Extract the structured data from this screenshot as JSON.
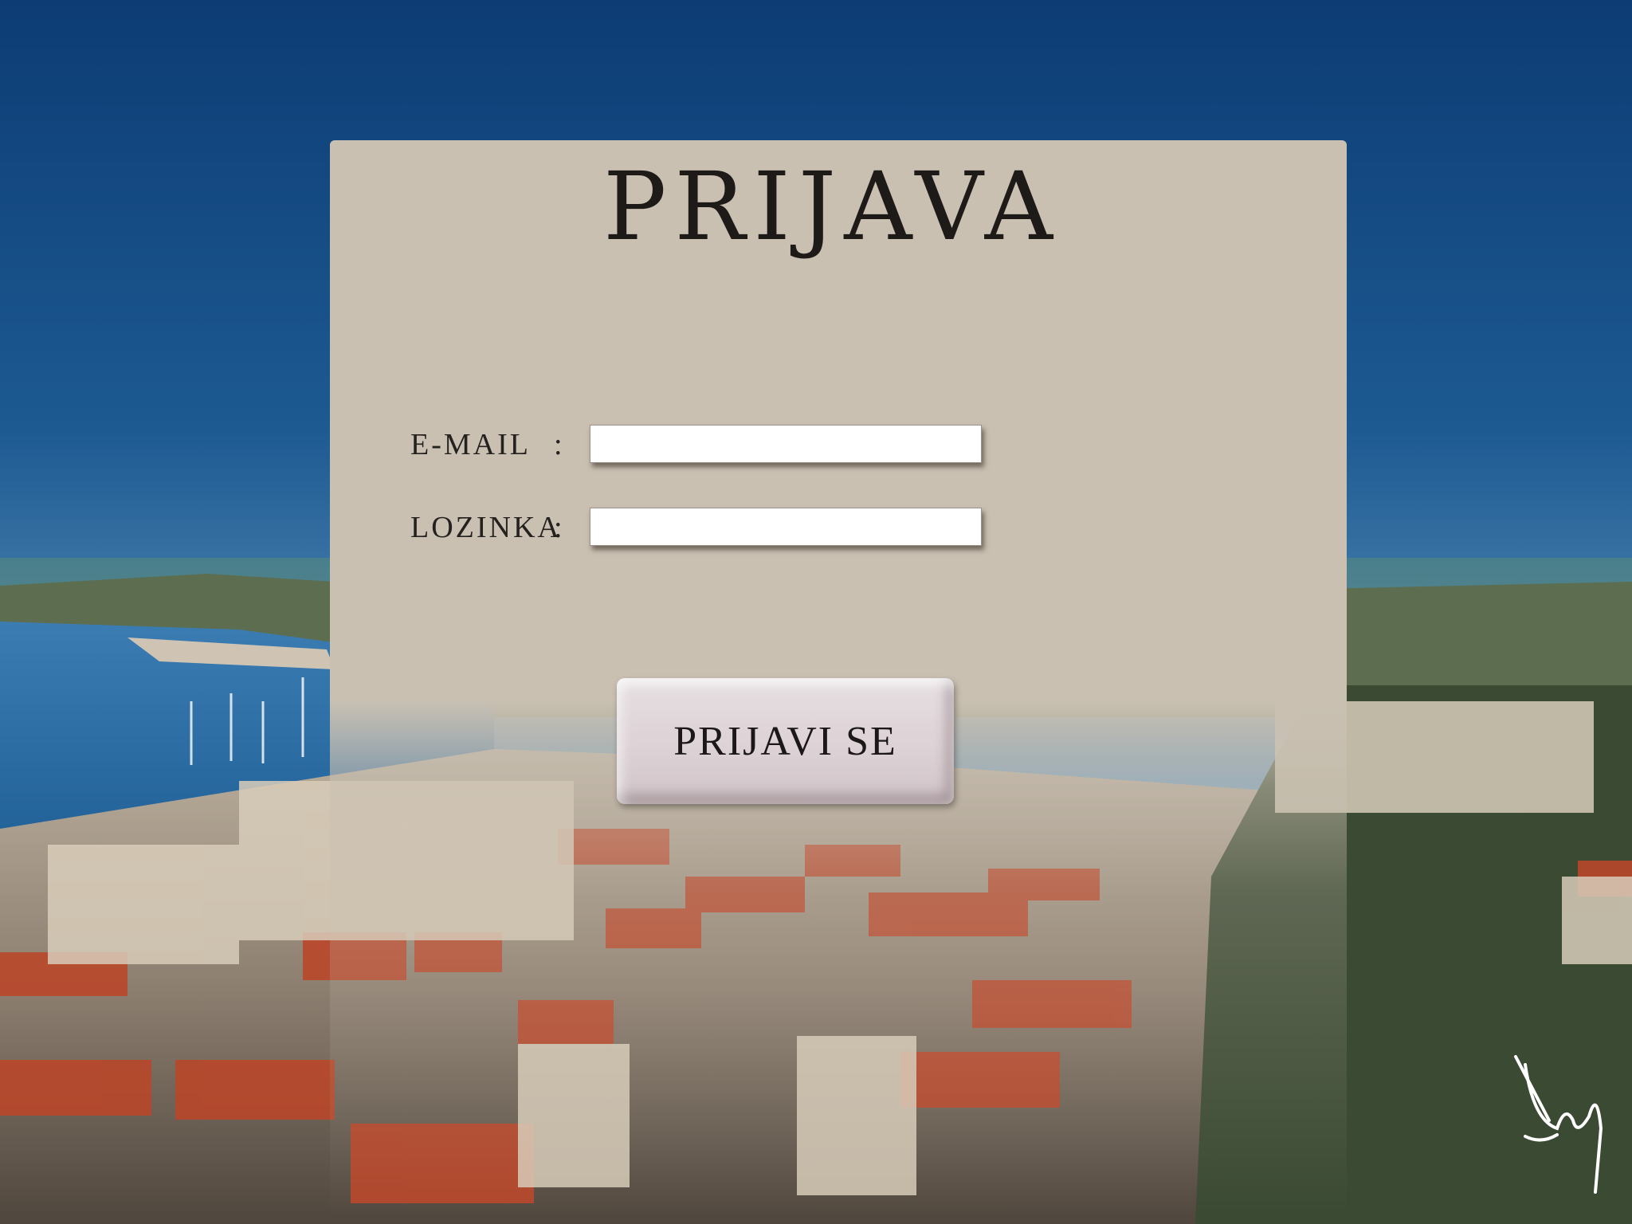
{
  "login": {
    "title": "PRIJAVA",
    "email_label": "E-MAIL",
    "password_label": "LOZINKA",
    "colon": ":",
    "email_value": "",
    "password_value": "",
    "submit_label": "PRIJAVI SE"
  },
  "colors": {
    "panel": "#c9c0b2",
    "button": "#ddd2d6",
    "sky": "#1b4f86",
    "roof": "#b84a2c"
  },
  "decor": {
    "signature": "handwritten signature (bottom-right)"
  }
}
